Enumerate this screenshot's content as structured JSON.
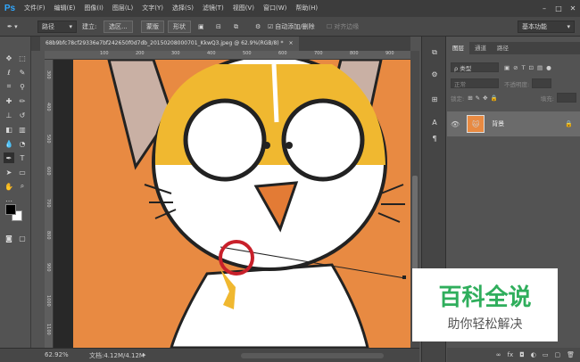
{
  "app": {
    "logo": "Ps",
    "accent": "#31a8ff"
  },
  "menu": [
    "文件(F)",
    "编辑(E)",
    "图像(I)",
    "图层(L)",
    "文字(Y)",
    "选择(S)",
    "滤镜(T)",
    "视图(V)",
    "窗口(W)",
    "帮助(H)"
  ],
  "window_controls": [
    "–",
    "□",
    "✕"
  ],
  "options_bar": {
    "path_mode": "路径",
    "make_label": "建立:",
    "selection_btn": "选区...",
    "mask_btn": "蒙版",
    "shape_btn": "形状",
    "auto_add_delete": "自动添加/删除",
    "align_edges": "对齐边缘",
    "workspace": "基本功能"
  },
  "document_tab": {
    "title": "68b9bfc78cf29336e7bf242650f0d7db_20150208000701_KkwQ3.jpeg @ 62.9%(RGB/8) *",
    "close": "×"
  },
  "ruler_top": [
    "100",
    "200",
    "300",
    "400",
    "500",
    "600",
    "700",
    "800",
    "900"
  ],
  "ruler_left": [
    "300",
    "400",
    "500",
    "600",
    "700",
    "800",
    "900",
    "1000",
    "1100"
  ],
  "status": {
    "zoom": "62.92%",
    "doc_size": "文档:4.12M/4.12M"
  },
  "layers_panel": {
    "tabs": [
      "图层",
      "通道",
      "路径"
    ],
    "kind_filter": "ρ 类型",
    "blend_mode": "正常",
    "opacity_label": "不透明度:",
    "lock_label": "锁定:",
    "fill_label": "填充:",
    "layer_name": "背景",
    "footer_icons": [
      "link-icon",
      "fx-icon",
      "mask-icon",
      "adjustment-icon",
      "folder-icon",
      "new-layer-icon",
      "trash-icon"
    ],
    "footer_labels": [
      "∞",
      "fx",
      "◘",
      "◐",
      "▭",
      "▢",
      "🗑"
    ]
  },
  "watermark": {
    "title": "百科全说",
    "subtitle": "助你轻松解决",
    "color": "#2fae5c"
  },
  "colors": {
    "canvas_bg": "#e88a42",
    "cat_yellow": "#f0b830",
    "annotation_red": "#c8202a"
  }
}
